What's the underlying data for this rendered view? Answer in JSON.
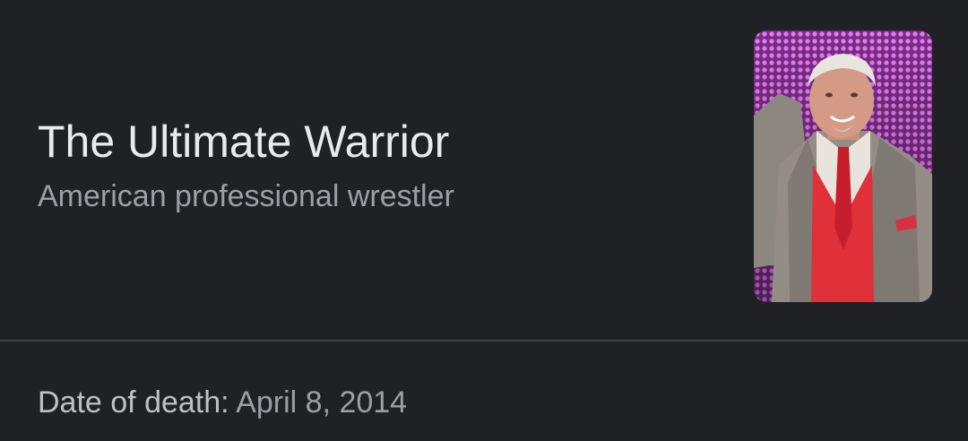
{
  "entity": {
    "title": "The Ultimate Warrior",
    "subtitle": "American professional wrestler"
  },
  "thumbnail": {
    "icon": "person-photo",
    "description_colors": {
      "backdrop": "#c84fd8",
      "suit": "#8f8a82",
      "shirt": "#e0303a"
    }
  },
  "facts": [
    {
      "label": "Date of death:",
      "value": "April 8, 2014"
    }
  ],
  "colors": {
    "background": "#202124",
    "title": "#e8eaed",
    "secondary": "#9aa0a6",
    "divider": "#3c4043"
  }
}
